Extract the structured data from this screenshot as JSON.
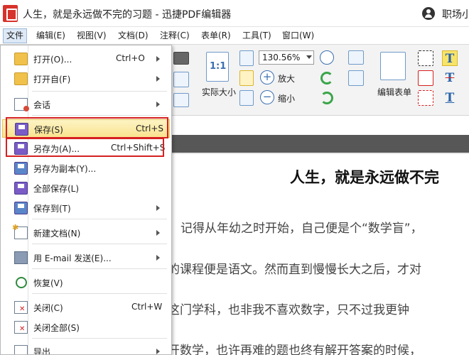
{
  "window": {
    "title": "人生，就是永远做不完的习题 - 迅捷PDF编辑器",
    "user_name": "职场小"
  },
  "menubar": {
    "items": [
      {
        "label": "文件"
      },
      {
        "label": "编辑(E)"
      },
      {
        "label": "视图(V)"
      },
      {
        "label": "文档(D)"
      },
      {
        "label": "注释(C)"
      },
      {
        "label": "表单(R)"
      },
      {
        "label": "工具(T)"
      },
      {
        "label": "窗口(W)"
      }
    ]
  },
  "ribbon": {
    "actual_size_label": "实际大小",
    "zoom_value": "130.56%",
    "zoom_in_label": "放大",
    "zoom_out_label": "缩小",
    "edit_form_label": "编辑表单",
    "one_to_one_label": "1:1"
  },
  "file_menu": {
    "items": [
      {
        "label": "打开(O)...",
        "shortcut": "Ctrl+O",
        "submenu": true,
        "icon": "folder-open-icon"
      },
      {
        "label": "打开自(F)",
        "shortcut": "",
        "submenu": true,
        "icon": "folder-from-icon"
      },
      {
        "label": "会话",
        "shortcut": "",
        "submenu": true,
        "icon": "session-icon"
      },
      {
        "label": "保存(S)",
        "shortcut": "Ctrl+S",
        "submenu": false,
        "icon": "save-icon"
      },
      {
        "label": "另存为(A)...",
        "shortcut": "Ctrl+Shift+S",
        "submenu": false,
        "icon": "save-as-icon"
      },
      {
        "label": "另存为副本(Y)...",
        "shortcut": "",
        "submenu": false,
        "icon": "save-copy-icon"
      },
      {
        "label": "全部保存(L)",
        "shortcut": "",
        "submenu": false,
        "icon": "save-all-icon"
      },
      {
        "label": "保存到(T)",
        "shortcut": "",
        "submenu": true,
        "icon": "save-to-icon"
      },
      {
        "label": "新建文档(N)",
        "shortcut": "",
        "submenu": true,
        "icon": "new-document-icon"
      },
      {
        "label": "用 E-mail 发送(E)...",
        "shortcut": "",
        "submenu": true,
        "icon": "email-icon"
      },
      {
        "label": "恢复(V)",
        "shortcut": "",
        "submenu": false,
        "icon": "restore-icon"
      },
      {
        "label": "关闭(C)",
        "shortcut": "Ctrl+W",
        "submenu": false,
        "icon": "close-document-icon"
      },
      {
        "label": "关闭全部(S)",
        "shortcut": "",
        "submenu": false,
        "icon": "close-all-icon"
      },
      {
        "label": "导出",
        "shortcut": "",
        "submenu": true,
        "icon": "export-icon"
      }
    ]
  },
  "document": {
    "heading": "人生，就是永远做不完",
    "lines": [
      "记得从年幼之时开始，自己便是个“数学盲”，",
      "的课程便是语文。然而直到慢慢长大之后，才对",
      "这门学科，也非我不喜欢数字，只不过我更钟",
      "开数学，也许再难的题也终有解开答案的时候，"
    ]
  },
  "colors": {
    "highlight_border": "#d62020",
    "menu_highlight": "#fae38f",
    "brand_red": "#d7322b"
  }
}
